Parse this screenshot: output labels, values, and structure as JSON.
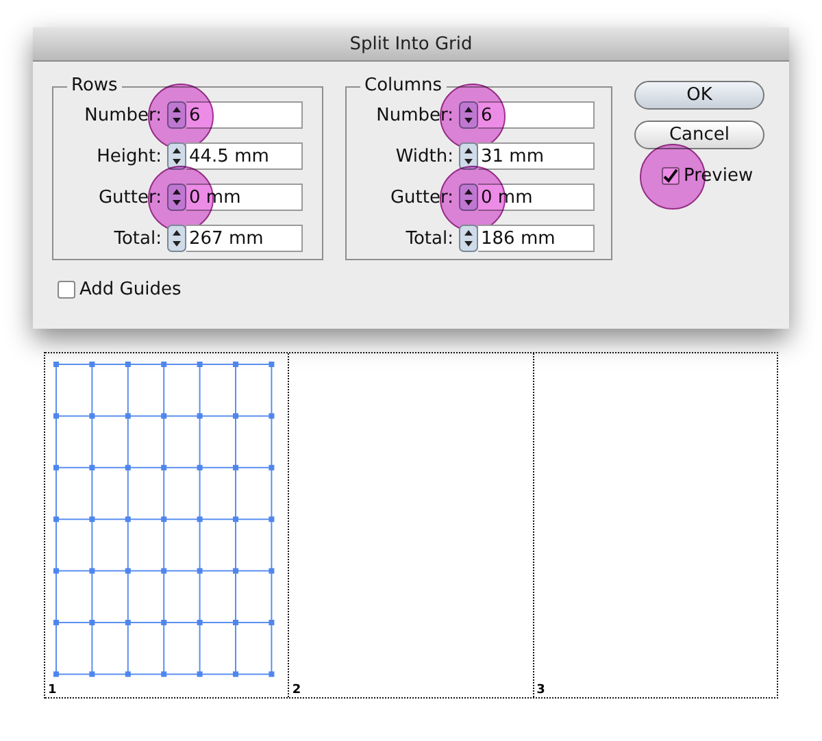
{
  "window": {
    "title": "Split Into Grid"
  },
  "groups": [
    {
      "title": "Rows",
      "fields": [
        {
          "label": "Number:",
          "value": "6",
          "highlighted": true
        },
        {
          "label": "Height:",
          "value": "44.5 mm",
          "highlighted": false
        },
        {
          "label": "Gutter:",
          "value": "0 mm",
          "highlighted": true
        },
        {
          "label": "Total:",
          "value": "267 mm",
          "highlighted": false
        }
      ]
    },
    {
      "title": "Columns",
      "fields": [
        {
          "label": "Number:",
          "value": "6",
          "highlighted": true
        },
        {
          "label": "Width:",
          "value": "31 mm",
          "highlighted": false
        },
        {
          "label": "Gutter:",
          "value": "0 mm",
          "highlighted": true
        },
        {
          "label": "Total:",
          "value": "186 mm",
          "highlighted": false
        }
      ]
    }
  ],
  "buttons": [
    {
      "label": "OK",
      "default": true
    },
    {
      "label": "Cancel",
      "default": false
    }
  ],
  "preview": {
    "label": "Preview",
    "checked": true,
    "highlighted": true
  },
  "add_guides": {
    "label": "Add Guides",
    "checked": false
  },
  "pages": [
    {
      "number": "1",
      "has_grid": true
    },
    {
      "number": "2",
      "has_grid": false
    },
    {
      "number": "3",
      "has_grid": false
    }
  ]
}
